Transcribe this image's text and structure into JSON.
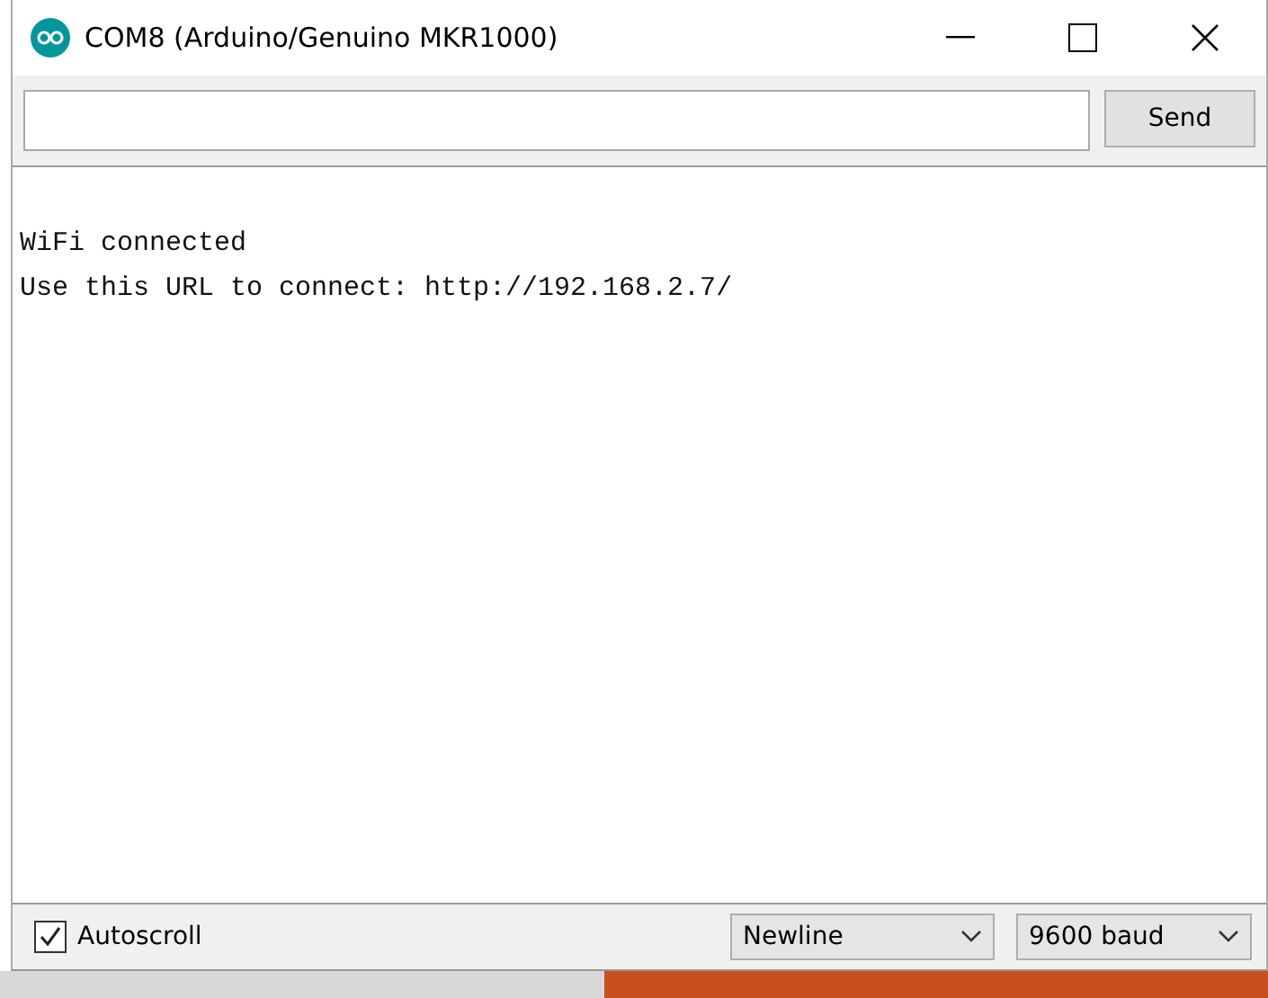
{
  "window": {
    "title": "COM8 (Arduino/Genuino MKR1000)"
  },
  "send_button": "Send",
  "output_lines": [
    "WiFi connected",
    "Use this URL to connect: http://192.168.2.7/"
  ],
  "autoscroll": {
    "label": "Autoscroll",
    "checked": true
  },
  "line_ending": "Newline",
  "baud_rate": "9600 baud"
}
